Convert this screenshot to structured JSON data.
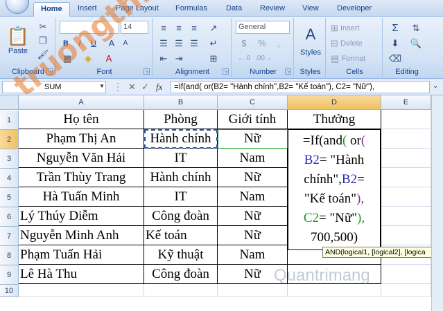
{
  "ribbon": {
    "tabs": [
      "Home",
      "Insert",
      "Page Layout",
      "Formulas",
      "Data",
      "Review",
      "View",
      "Developer"
    ],
    "active_tab": "Home",
    "clipboard": {
      "label": "Clipboard",
      "paste": "Paste"
    },
    "font": {
      "label": "Font",
      "font_size": "14"
    },
    "alignment": {
      "label": "Alignment"
    },
    "number": {
      "label": "Number",
      "format": "General",
      "currency": "$",
      "percent": "%"
    },
    "styles": {
      "label": "Styles"
    },
    "cells": {
      "label": "Cells",
      "insert": "Insert",
      "delete": "Delete",
      "format": "Format"
    },
    "editing": {
      "label": "Editing",
      "sum": "Σ"
    }
  },
  "formula_bar": {
    "name_box": "SUM",
    "cancel": "✕",
    "enter": "✓",
    "fx": "fx",
    "formula": "=If(and( or(B2= \"Hành chính\",B2= \"Kế toán\"), C2= \"Nữ\"),"
  },
  "grid": {
    "columns": [
      "A",
      "B",
      "C",
      "D",
      "E"
    ],
    "rows": [
      "1",
      "2",
      "3",
      "4",
      "5",
      "6",
      "7",
      "8",
      "9",
      "10"
    ],
    "headers": [
      "Họ tên",
      "Phòng",
      "Giới tính",
      "Thưởng"
    ],
    "data": [
      [
        "Phạm Thị An",
        "Hành chính",
        "Nữ"
      ],
      [
        "Nguyễn Văn Hải",
        "IT",
        "Nam"
      ],
      [
        "Trần Thùy Trang",
        "Hành chính",
        "Nữ"
      ],
      [
        "Hà Tuấn Minh",
        "IT",
        "Nam"
      ],
      [
        "Lý Thúy Diễm",
        "Công đoàn",
        "Nữ"
      ],
      [
        "Nguyễn Minh Anh",
        "Kế toán",
        "Nữ"
      ],
      [
        "Phạm Tuấn Hải",
        "Kỹ thuật",
        "Nam"
      ],
      [
        "Lê Hà Thu",
        "Công đoàn",
        "Nữ"
      ]
    ],
    "editing": {
      "l1a": "=If(and",
      "l1b": "( ",
      "l1c": "or",
      "l1d": "(",
      "l2a": "B2",
      "l2b": "= \"Hành",
      "l3a": "chính\",",
      "l3b": "B2",
      "l3c": "=",
      "l4a": "\"Kế toán\"",
      "l4b": "),",
      "l5a": "C2",
      "l5b": "= \"Nữ\"",
      "l5c": "),",
      "l6": "700,500)"
    },
    "tooltip": "AND(logical1, [logical2], [logica"
  },
  "watermarks": {
    "brand1": "truongthi",
    "brand2": "Quantrimang"
  },
  "colors": {
    "accent": "#f1c15f",
    "ribbon": "#d3e2f5"
  }
}
